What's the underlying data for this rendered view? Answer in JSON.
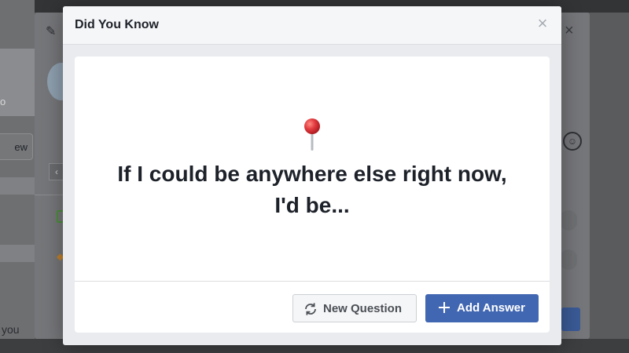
{
  "background": {
    "photo_caption": "o",
    "view_button_label": "ew",
    "bottom_text": "you"
  },
  "modal": {
    "title": "Did You Know",
    "close_icon": "close-icon",
    "emoji_icon": "round-pushpin-icon",
    "question": "If I could be anywhere else right now, I'd be...",
    "buttons": {
      "new_question": "New Question",
      "add_answer": "Add Answer"
    }
  },
  "colors": {
    "primary": "#4267b2",
    "modal_bg": "#e9ebee",
    "header_bg": "#f5f6f7",
    "text": "#1d2129",
    "pin_red": "#e0393e"
  }
}
